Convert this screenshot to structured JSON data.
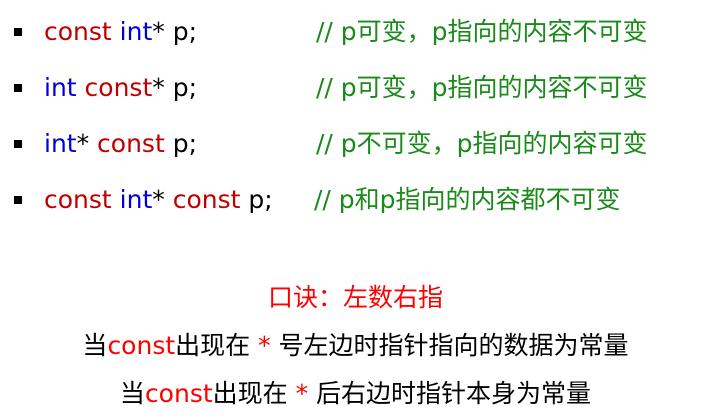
{
  "colors": {
    "const_keyword": "#c00000",
    "int_keyword": "#0000dd",
    "comment": "#1a8a1a",
    "mnemonic": "#ff0000",
    "plain": "#000000"
  },
  "rows": [
    {
      "code": [
        "const",
        " ",
        "int",
        "* p;"
      ],
      "comment": "// p可变，p指向的内容不可变"
    },
    {
      "code": [
        "int",
        " ",
        "const",
        "* p;"
      ],
      "comment": "// p可变，p指向的内容不可变"
    },
    {
      "code": [
        "int",
        "* ",
        "const",
        " p;"
      ],
      "comment": "// p不可变，p指向的内容可变"
    },
    {
      "code": [
        "const",
        " ",
        "int",
        "* ",
        "const",
        " p;"
      ],
      "comment": "// p和p指向的内容都不可变"
    }
  ],
  "mnemonic": "口诀：左数右指",
  "rules": [
    {
      "prefix": "当",
      "keyword": "const",
      "middle": "出现在 ",
      "star": "*",
      "suffix": " 号左边时指针指向的数据为常量"
    },
    {
      "prefix": "当",
      "keyword": "const",
      "middle": "出现在 ",
      "star": "*",
      "suffix": " 后右边时指针本身为常量"
    }
  ]
}
